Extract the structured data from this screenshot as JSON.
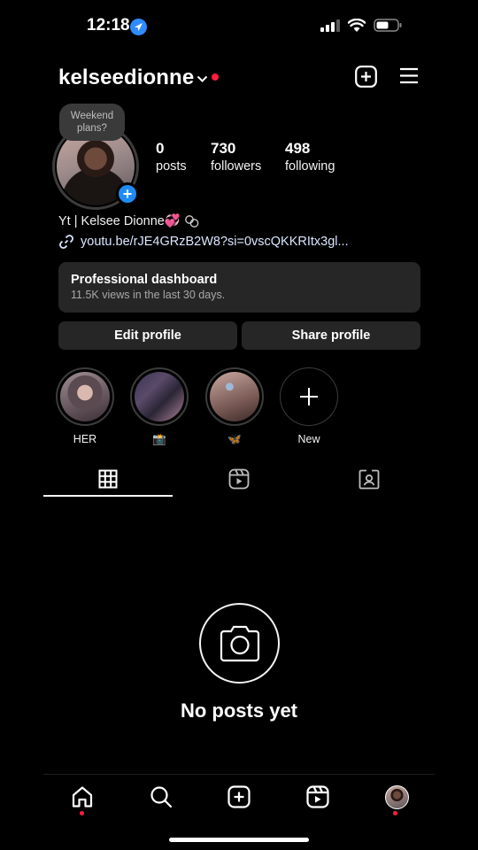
{
  "status_bar": {
    "time": "12:18"
  },
  "header": {
    "username": "kelseedionne"
  },
  "profile": {
    "note": "Weekend plans?",
    "stats": [
      {
        "value": "0",
        "label": "posts"
      },
      {
        "value": "730",
        "label": "followers"
      },
      {
        "value": "498",
        "label": "following"
      }
    ],
    "bio": "Yt | Kelsee Dionne💞",
    "link": "youtu.be/rJE4GRzB2W8?si=0vscQKKRItx3gl..."
  },
  "dashboard": {
    "title": "Professional dashboard",
    "subtitle": "11.5K views in the last 30 days."
  },
  "buttons": {
    "edit": "Edit profile",
    "share": "Share profile"
  },
  "highlights": [
    {
      "label": "HER"
    },
    {
      "label": "📸"
    },
    {
      "label": "🦋"
    },
    {
      "label": "New"
    }
  ],
  "empty_state": {
    "message": "No posts yet"
  },
  "colors": {
    "accent_blue": "#1f8bf5",
    "notification_red": "#ff1e3c",
    "card_bg": "#262626"
  }
}
